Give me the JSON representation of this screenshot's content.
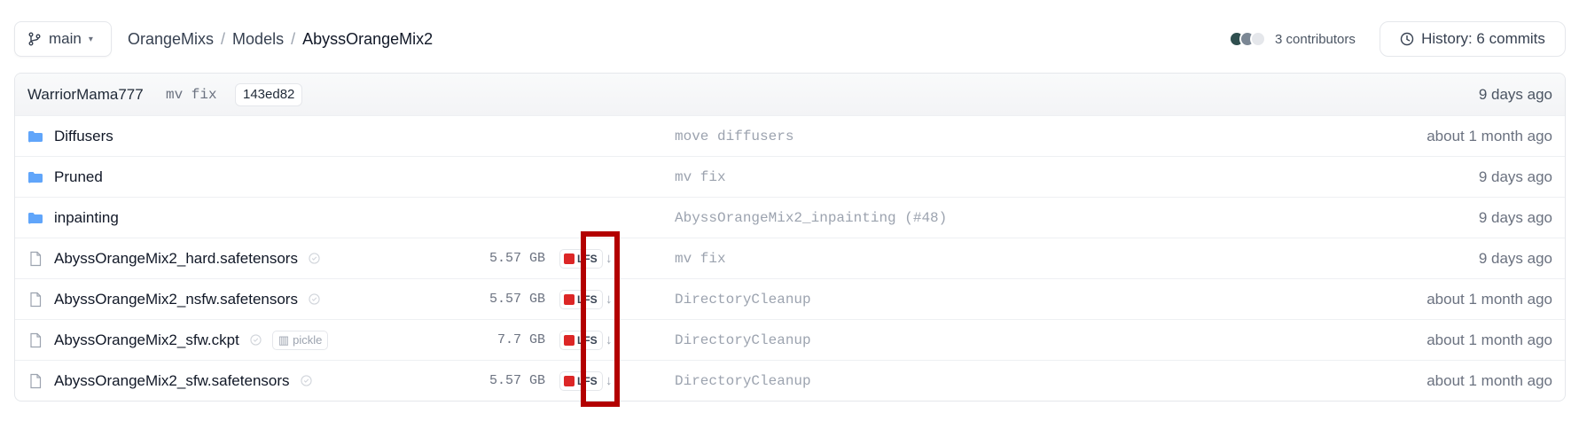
{
  "topbar": {
    "branch": "main",
    "breadcrumb": [
      "OrangeMixs",
      "Models",
      "AbyssOrangeMix2"
    ],
    "contributors": "3 contributors",
    "history": "History: 6 commits"
  },
  "last_commit": {
    "author": "WarriorMama777",
    "message": "mv fix",
    "hash": "143ed82",
    "time": "9 days ago"
  },
  "entries": [
    {
      "type": "folder",
      "name": "Diffusers",
      "commit": "move diffusers",
      "time": "about 1 month ago"
    },
    {
      "type": "folder",
      "name": "Pruned",
      "commit": "mv fix",
      "time": "9 days ago"
    },
    {
      "type": "folder",
      "name": "inpainting",
      "commit": "AbyssOrangeMix2_inpainting (#48)",
      "time": "9 days ago"
    },
    {
      "type": "file",
      "name": "AbyssOrangeMix2_hard.safetensors",
      "size": "5.57 GB",
      "lfs": "LFS",
      "commit": "mv fix",
      "time": "9 days ago"
    },
    {
      "type": "file",
      "name": "AbyssOrangeMix2_nsfw.safetensors",
      "size": "5.57 GB",
      "lfs": "LFS",
      "commit": "DirectoryCleanup",
      "time": "about 1 month ago"
    },
    {
      "type": "file",
      "name": "AbyssOrangeMix2_sfw.ckpt",
      "badge": "pickle",
      "size": "7.7 GB",
      "lfs": "LFS",
      "commit": "DirectoryCleanup",
      "time": "about 1 month ago"
    },
    {
      "type": "file",
      "name": "AbyssOrangeMix2_sfw.safetensors",
      "size": "5.57 GB",
      "lfs": "LFS",
      "commit": "DirectoryCleanup",
      "time": "about 1 month ago"
    }
  ],
  "colors": {
    "folder": "#60a5fa",
    "lfs": "#dc2626",
    "highlight": "#b30000"
  }
}
